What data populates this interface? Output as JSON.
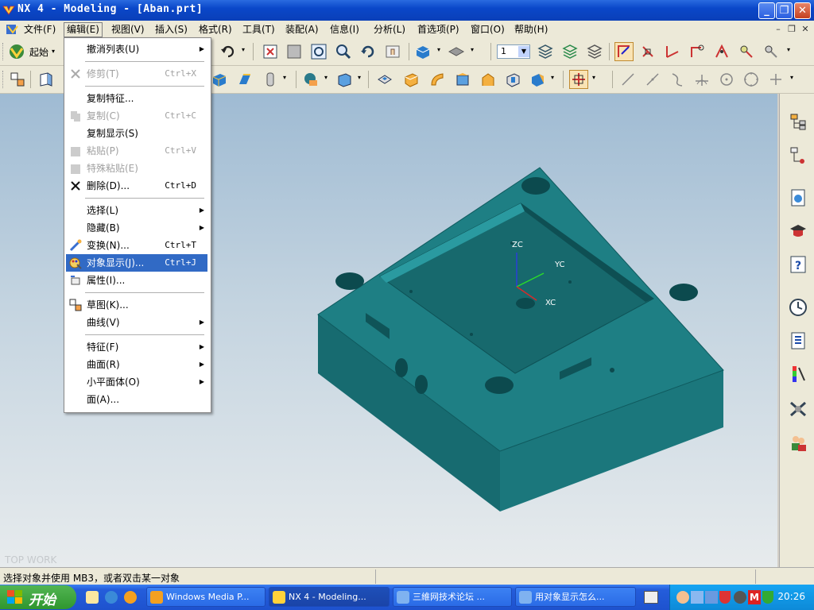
{
  "window": {
    "title": "NX 4 - Modeling - [Aban.prt]"
  },
  "menubar": {
    "items": [
      "文件(F)",
      "编辑(E)",
      "视图(V)",
      "插入(S)",
      "格式(R)",
      "工具(T)",
      "装配(A)",
      "信息(I)",
      "分析(L)",
      "首选项(P)",
      "窗口(O)",
      "帮助(H)"
    ]
  },
  "toolbar1": {
    "start_label": "起始",
    "layer_value": "1"
  },
  "edit_menu": {
    "items": [
      {
        "label": "撤消列表(U)",
        "shortcut": "",
        "submenu": true,
        "enabled": true
      },
      {
        "label": "修剪(T)",
        "shortcut": "Ctrl+X",
        "submenu": false,
        "enabled": false
      },
      {
        "label": "复制特征...",
        "shortcut": "",
        "submenu": false,
        "enabled": true
      },
      {
        "label": "复制(C)",
        "shortcut": "Ctrl+C",
        "submenu": false,
        "enabled": false
      },
      {
        "label": "复制显示(S)",
        "shortcut": "",
        "submenu": false,
        "enabled": true
      },
      {
        "label": "粘贴(P)",
        "shortcut": "Ctrl+V",
        "submenu": false,
        "enabled": false
      },
      {
        "label": "特殊粘贴(E)",
        "shortcut": "",
        "submenu": false,
        "enabled": false
      },
      {
        "label": "删除(D)...",
        "shortcut": "Ctrl+D",
        "submenu": false,
        "enabled": true
      },
      {
        "label": "选择(L)",
        "shortcut": "",
        "submenu": true,
        "enabled": true
      },
      {
        "label": "隐藏(B)",
        "shortcut": "",
        "submenu": true,
        "enabled": true
      },
      {
        "label": "变换(N)...",
        "shortcut": "Ctrl+T",
        "submenu": false,
        "enabled": true
      },
      {
        "label": "对象显示(J)...",
        "shortcut": "Ctrl+J",
        "submenu": false,
        "enabled": true,
        "highlighted": true
      },
      {
        "label": "属性(I)...",
        "shortcut": "",
        "submenu": false,
        "enabled": true
      },
      {
        "label": "草图(K)...",
        "shortcut": "",
        "submenu": false,
        "enabled": true
      },
      {
        "label": "曲线(V)",
        "shortcut": "",
        "submenu": true,
        "enabled": true
      },
      {
        "label": "特征(F)",
        "shortcut": "",
        "submenu": true,
        "enabled": true
      },
      {
        "label": "曲面(R)",
        "shortcut": "",
        "submenu": true,
        "enabled": true
      },
      {
        "label": "小平面体(O)",
        "shortcut": "",
        "submenu": true,
        "enabled": true
      },
      {
        "label": "面(A)...",
        "shortcut": "",
        "submenu": false,
        "enabled": true
      }
    ]
  },
  "viewport": {
    "axes": {
      "zc": "ZC",
      "yc": "YC",
      "xc": "XC"
    },
    "watermark": "TOP WORK",
    "model_color": "#1e7f84"
  },
  "statusbar": {
    "message": "选择对象并使用 MB3，或者双击某一对象"
  },
  "taskbar": {
    "start_label": "开始",
    "tasks": [
      "Windows Media P...",
      "NX 4 - Modeling...",
      "三維网技术论坛 ...",
      "用对象显示怎么..."
    ],
    "clock": "20:26"
  },
  "colors": {
    "title_blue": "#0a47c9",
    "highlight": "#316ac5",
    "taskbar_blue": "#245ddb",
    "start_green": "#3aa53a"
  }
}
